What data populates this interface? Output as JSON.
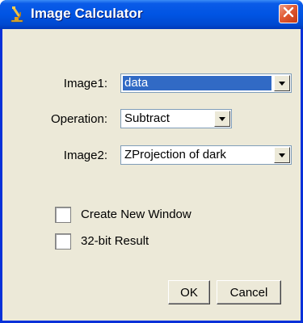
{
  "window": {
    "title": "Image Calculator"
  },
  "icons": {
    "app": "microscope-icon",
    "close": "close-icon"
  },
  "form": {
    "image1": {
      "label": "Image1:",
      "value": "data"
    },
    "operation": {
      "label": "Operation:",
      "value": "Subtract"
    },
    "image2": {
      "label": "Image2:",
      "value": "ZProjection of dark"
    }
  },
  "options": {
    "create_new_window": {
      "label": "Create New Window",
      "checked": false
    },
    "result_32bit": {
      "label": "32-bit Result",
      "checked": false
    }
  },
  "buttons": {
    "ok": "OK",
    "cancel": "Cancel"
  },
  "colors": {
    "titlebar": "#0054e3",
    "close": "#e05a33",
    "selection": "#316ac5",
    "dialog": "#ece9d8"
  }
}
